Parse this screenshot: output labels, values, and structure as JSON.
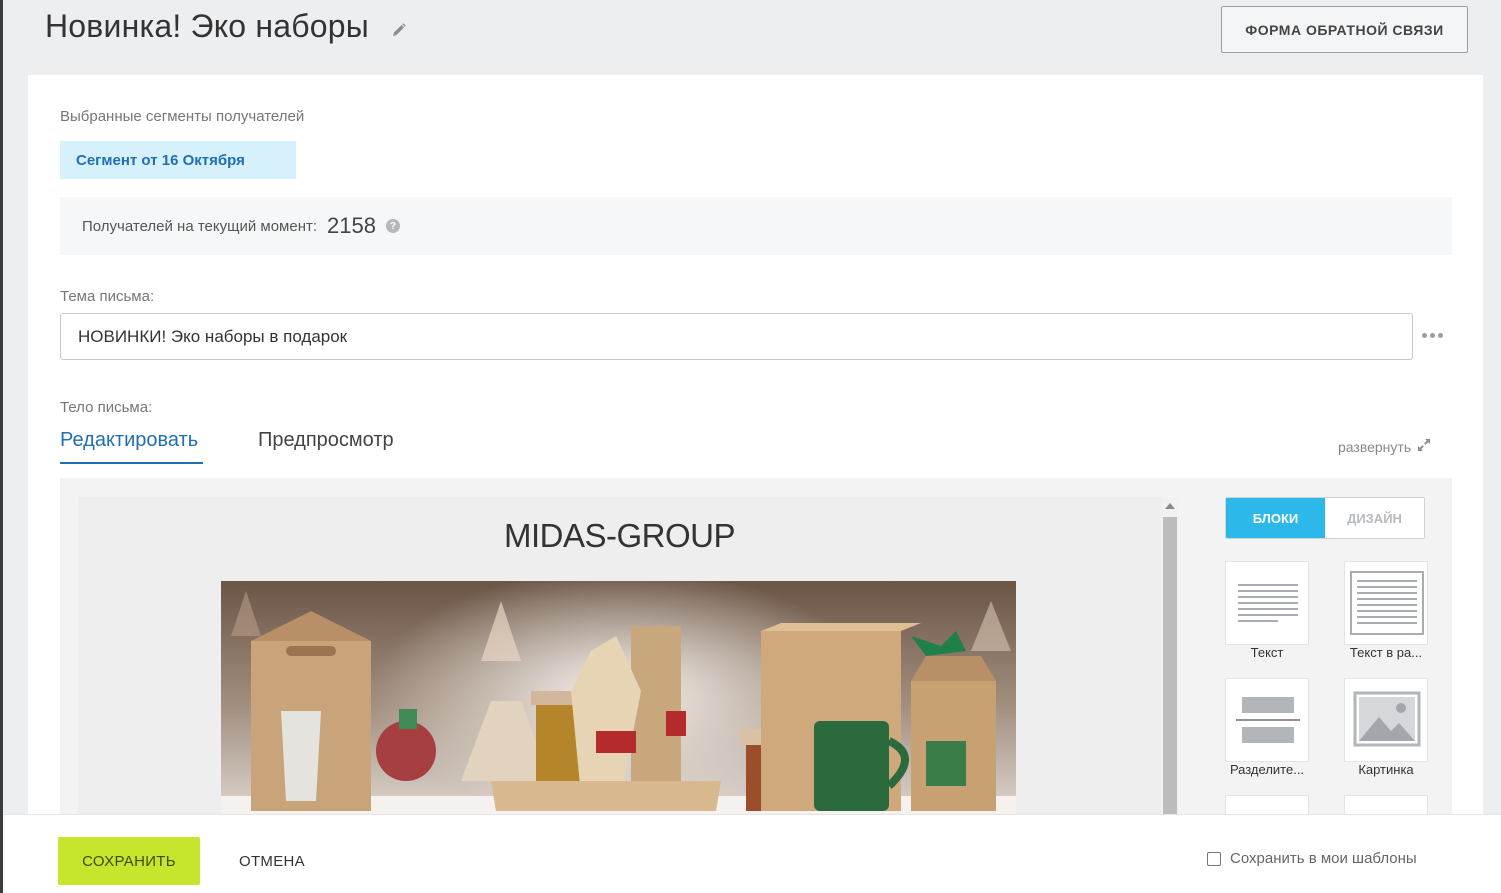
{
  "header": {
    "title": "Новинка! Эко наборы",
    "feedback_button": "ФОРМА ОБРАТНОЙ СВЯЗИ"
  },
  "segments": {
    "label": "Выбранные сегменты получателей",
    "chip": "Сегмент от 16 Октября"
  },
  "recipients": {
    "label": "Получателей на текущий момент:",
    "count": "2158"
  },
  "subject": {
    "label": "Тема письма:",
    "value": "НОВИНКИ! Эко наборы в подарок"
  },
  "body": {
    "label": "Тело письма:",
    "tabs": [
      "Редактировать",
      "Предпросмотр"
    ],
    "expand_label": "развернуть"
  },
  "email": {
    "title": "MIDAS-GROUP"
  },
  "panel": {
    "tabs": [
      "БЛОКИ",
      "ДИЗАЙН"
    ],
    "blocks": [
      "Текст",
      "Текст в ра...",
      "Разделите...",
      "Картинка"
    ]
  },
  "footer": {
    "save": "СОХРАНИТЬ",
    "cancel": "ОТМЕНА",
    "save_template": "Сохранить в мои шаблоны"
  },
  "colors": {
    "accent_blue": "#1f6fb2",
    "chip_bg": "#d6f1fc",
    "blocks_active": "#2db8ea",
    "save_green": "#c6e62d"
  }
}
